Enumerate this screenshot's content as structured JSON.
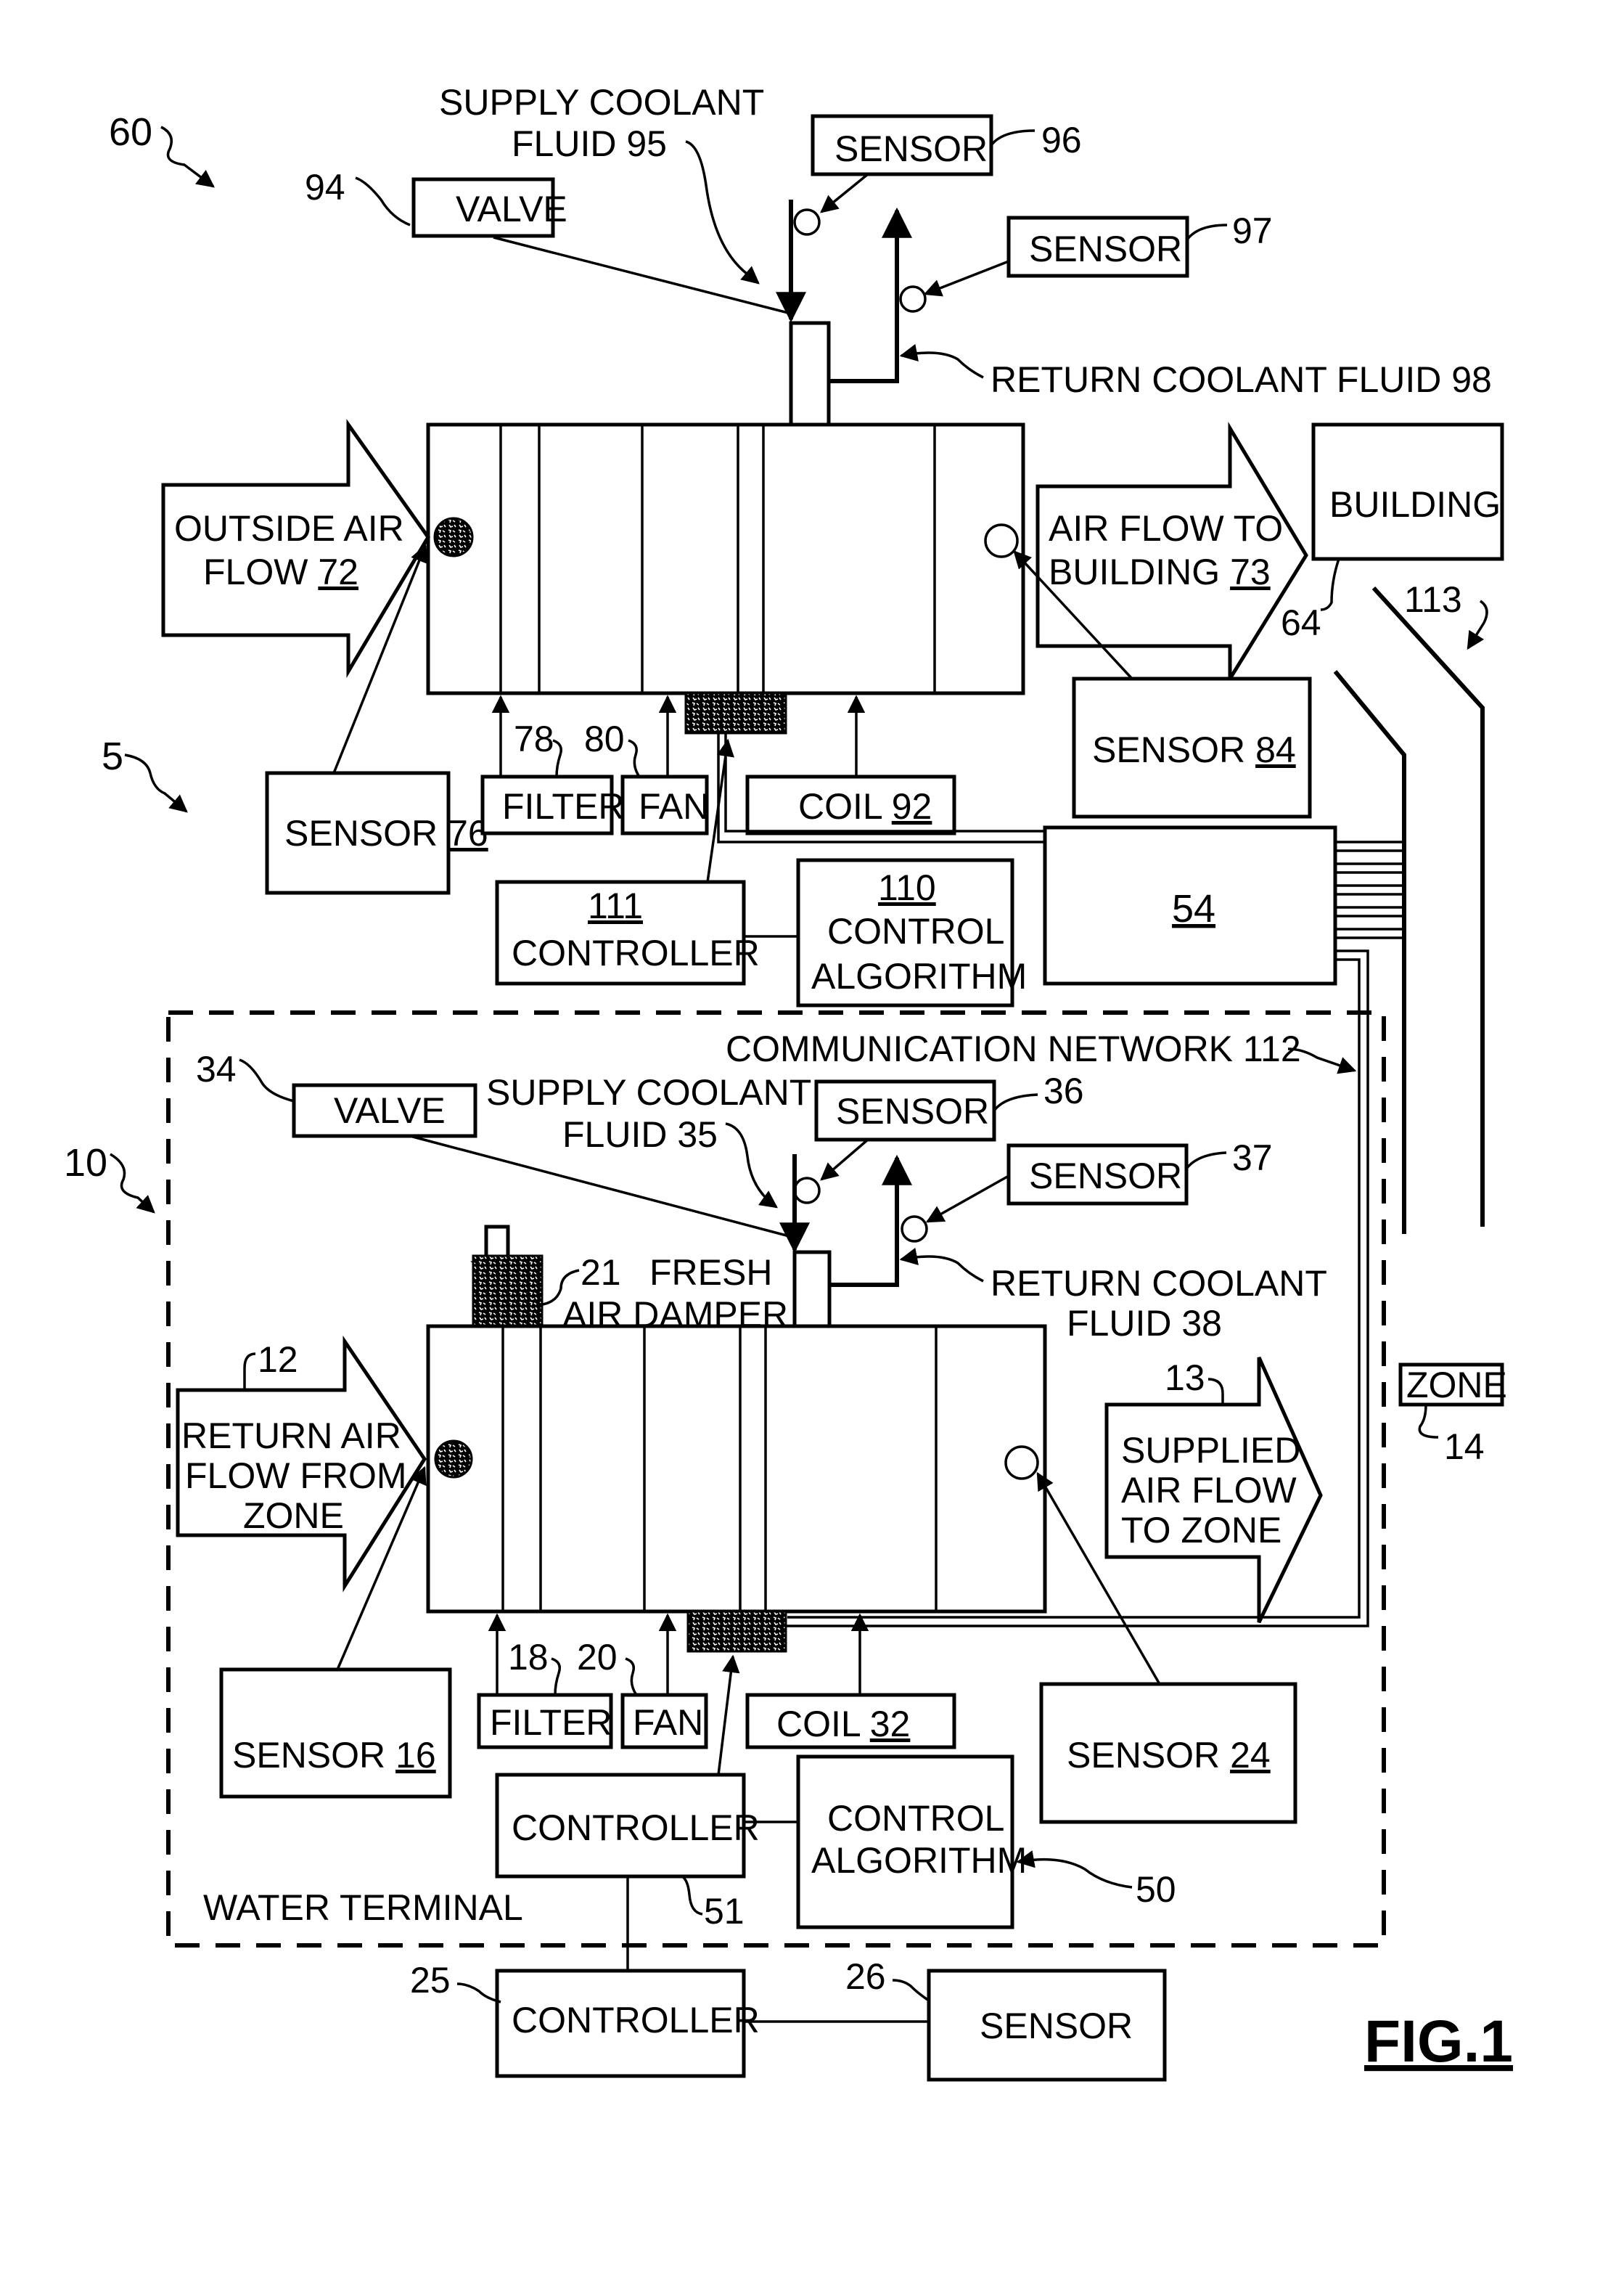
{
  "figure": {
    "title": "FIG.1",
    "system_refs": {
      "system": "5",
      "air_handler": "60",
      "water_terminal": "10"
    }
  },
  "top_unit": {
    "supply_coolant": {
      "line1": "SUPPLY COOLANT",
      "line2": "FLUID 95"
    },
    "valve": {
      "label": "VALVE",
      "ref": "94"
    },
    "sensor_supply": {
      "label": "SENSOR",
      "ref": "96"
    },
    "sensor_return": {
      "label": "SENSOR",
      "ref": "97"
    },
    "return_coolant": {
      "label": "RETURN COOLANT FLUID 98"
    },
    "outside_air": {
      "line1": "OUTSIDE AIR",
      "line2_text": "FLOW",
      "ref": "72"
    },
    "air_to_building": {
      "line1": "AIR FLOW TO",
      "line2_text": "BUILDING",
      "ref": "73"
    },
    "building": {
      "label": "BUILDING",
      "ref": "64"
    },
    "duct_ref": "113",
    "sensor_in": {
      "label": "SENSOR",
      "ref": "76"
    },
    "filter": {
      "label": "FILTER",
      "ref": "78"
    },
    "fan": {
      "label": "FAN",
      "ref": "80"
    },
    "coil": {
      "label": "COIL",
      "ref": "92"
    },
    "sensor_out": {
      "label": "SENSOR",
      "ref": "84"
    },
    "controller": {
      "label": "CONTROLLER",
      "ref": "111"
    },
    "algorithm": {
      "line1": "CONTROL",
      "line2": "ALGORITHM",
      "ref": "110"
    },
    "hub": {
      "ref": "54"
    }
  },
  "network": {
    "label": "COMMUNICATION NETWORK 112"
  },
  "terminal_unit": {
    "name": "WATER TERMINAL",
    "valve": {
      "label": "VALVE",
      "ref": "34"
    },
    "supply_coolant": {
      "line1": "SUPPLY COOLANT",
      "line2": "FLUID 35"
    },
    "sensor_supply": {
      "label": "SENSOR",
      "ref": "36"
    },
    "sensor_return": {
      "label": "SENSOR",
      "ref": "37"
    },
    "return_coolant": {
      "line1": "RETURN COOLANT",
      "line2": "FLUID 38"
    },
    "damper": {
      "ref": "21",
      "line1": "FRESH",
      "line2": "AIR DAMPER"
    },
    "return_air": {
      "ref": "12",
      "line1": "RETURN AIR",
      "line2": "FLOW FROM",
      "line3": "ZONE"
    },
    "supplied_air": {
      "ref": "13",
      "line1": "SUPPLIED",
      "line2": "AIR FLOW",
      "line3": "TO ZONE"
    },
    "zone": {
      "label": "ZONE",
      "ref": "14"
    },
    "sensor_in": {
      "label": "SENSOR",
      "ref": "16"
    },
    "filter": {
      "label": "FILTER",
      "ref": "18"
    },
    "fan": {
      "label": "FAN",
      "ref": "20"
    },
    "coil": {
      "label": "COIL",
      "ref": "32"
    },
    "sensor_out": {
      "label": "SENSOR",
      "ref": "24"
    },
    "controller": {
      "label": "CONTROLLER",
      "ref": "51"
    },
    "algorithm": {
      "line1": "CONTROL",
      "line2": "ALGORITHM",
      "ref": "50"
    }
  },
  "external": {
    "controller": {
      "label": "CONTROLLER",
      "ref": "25"
    },
    "sensor": {
      "label": "SENSOR",
      "ref": "26"
    }
  }
}
